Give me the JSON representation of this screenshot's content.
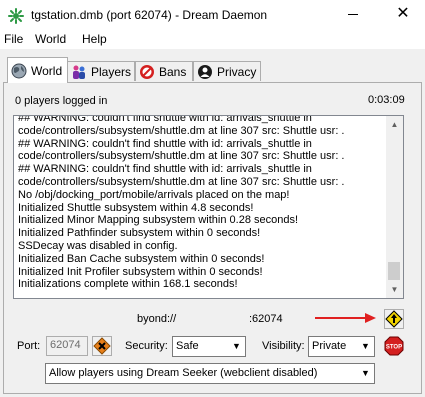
{
  "window": {
    "title": "tgstation.dmb (port 62074) - Dream Daemon",
    "close_glyph": "✕",
    "icons": {
      "app": "dream-daemon-icon",
      "minimize": "minimize-icon",
      "close": "close-icon"
    }
  },
  "menu": {
    "items": [
      "File",
      "World",
      "Help"
    ]
  },
  "tabs": [
    {
      "label": "World",
      "icon": "globe-icon",
      "active": true
    },
    {
      "label": "Players",
      "icon": "players-icon",
      "active": false
    },
    {
      "label": "Bans",
      "icon": "ban-icon",
      "active": false
    },
    {
      "label": "Privacy",
      "icon": "privacy-icon",
      "active": false
    }
  ],
  "status": {
    "players": "0 players logged in",
    "uptime": "0:03:09"
  },
  "log": {
    "lines": [
      "## WARNING: couldn't find shuttle with id: arrivals_shuttle in",
      "code/controllers/subsystem/shuttle.dm at line 307 src: Shuttle usr: .",
      "## WARNING: couldn't find shuttle with id: arrivals_shuttle in",
      "code/controllers/subsystem/shuttle.dm at line 307 src: Shuttle usr: .",
      "## WARNING: couldn't find shuttle with id: arrivals_shuttle in",
      "code/controllers/subsystem/shuttle.dm at line 307 src: Shuttle usr: .",
      "No /obj/docking_port/mobile/arrivals placed on the map!",
      "Initialized Shuttle subsystem within 4.8 seconds!",
      "Initialized Minor Mapping subsystem within 0.28 seconds!",
      "Initialized Pathfinder subsystem within 0 seconds!",
      "SSDecay was disabled in config.",
      "Initialized Ban Cache subsystem within 0 seconds!",
      "Initialized Init Profiler subsystem within 0 seconds!",
      "Initializations complete within 168.1 seconds!"
    ],
    "scroll_icons": {
      "up": "scroll-up-icon",
      "down": "scroll-down-icon"
    },
    "scroll_glyphs": {
      "up": "▲",
      "down": "▼"
    }
  },
  "server": {
    "url_label": "byond://",
    "port_display": ":62074",
    "icons": {
      "arrow": "arrow-icon",
      "launch": "launch-icon"
    }
  },
  "controls": {
    "port_label": "Port:",
    "port_value": "62074",
    "port_icon": "reset-port-icon",
    "security_label": "Security:",
    "security_value": "Safe",
    "visibility_label": "Visibility:",
    "visibility_value": "Private",
    "stop_icon": "stop-icon",
    "stop_label": "STOP",
    "webclient_value": "Allow players using Dream Seeker (webclient disabled)",
    "dropdown_glyph": "▼"
  },
  "colors": {
    "accent_arrow": "#e02020",
    "stop": "#d42020",
    "launch": "#f2d400",
    "tab_border": "#adadad"
  }
}
